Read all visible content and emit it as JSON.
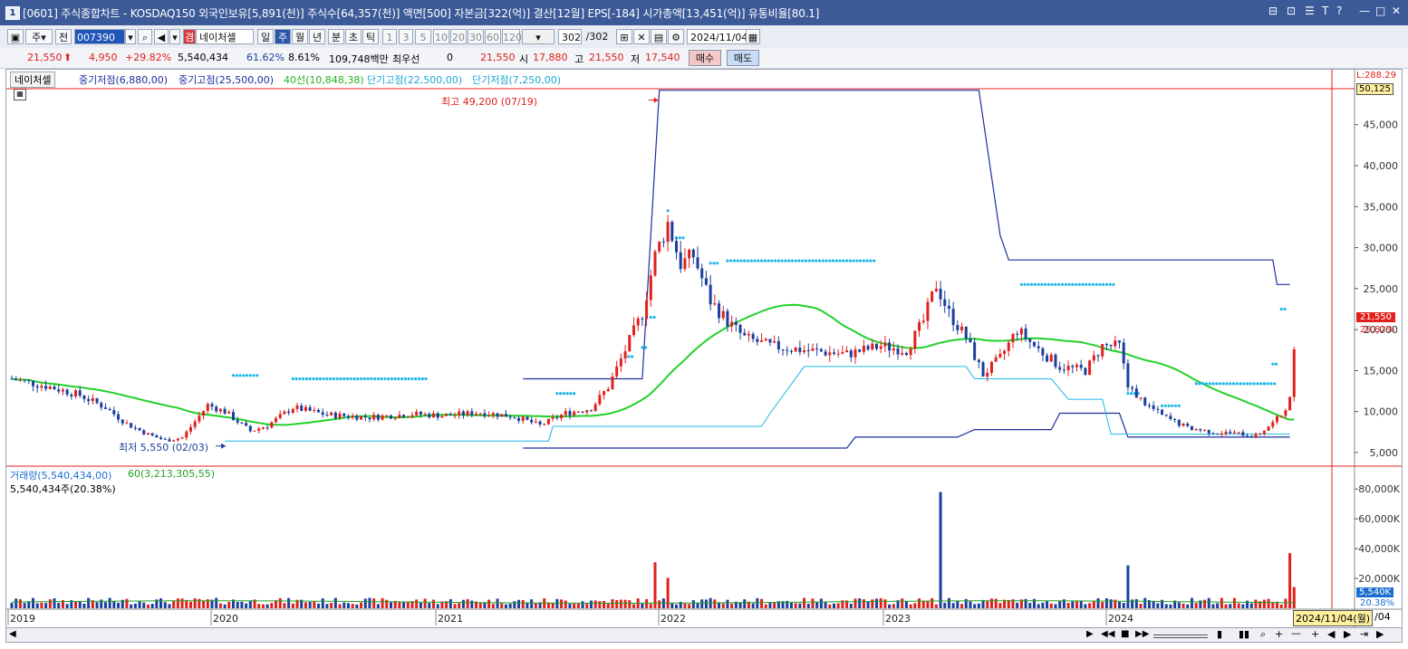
{
  "window": {
    "app_number": "1",
    "title": "[0601] 주식종합차트 - KOSDAQ150 외국인보유[5,891(천)] 주식수[64,357(천)] 액면[500] 자본금[322(억)] 결산[12월] EPS[-184] 시가총액[13,451(억)] 유통비율[80.1]"
  },
  "toolbar": {
    "period_select": "주",
    "all_label": "전",
    "stock_code": "007390",
    "stock_name": "네이처셀",
    "stock_badge": "겸",
    "timeframes": [
      "일",
      "주",
      "월",
      "년",
      "분",
      "초",
      "틱"
    ],
    "selected_timeframe": "주",
    "minute_options": [
      "1",
      "3",
      "5",
      "10",
      "20",
      "30",
      "60",
      "120"
    ],
    "count_display": "302",
    "count_total": "/302",
    "date": "2024/11/04"
  },
  "quote": {
    "price": "21,550",
    "change": "4,950",
    "change_pct": "+29.82%",
    "volume": "5,540,434",
    "vol_ratio": "61.62%",
    "turnover": "8.61%",
    "amount": "109,748백만",
    "pref_label": "최우선",
    "pref_value": "0",
    "price2": "21,550",
    "open_label": "시",
    "open": "17,880",
    "high_label": "고",
    "high": "21,550",
    "low_label": "저",
    "low": "17,540",
    "buy_label": "매수",
    "sell_label": "매도"
  },
  "chart": {
    "tab_label": "네이처셀",
    "legend": [
      {
        "text": "중기저점(6,880,00)",
        "color": "#1c2f9c"
      },
      {
        "text": "중기고점(25,500,00)",
        "color": "#1c2f9c"
      },
      {
        "text": "40선(10,848,38)",
        "color": "#22b322"
      },
      {
        "text": "단기고점(22,500,00)",
        "color": "#17a8d6"
      },
      {
        "text": "단기저점(7,250,00)",
        "color": "#17a8d6"
      }
    ],
    "high_annotation": "최고 49,200 (07/19)",
    "low_annotation": "최저 5,550 (02/03)",
    "price_axis_ticks": [
      "45,000",
      "40,000",
      "35,000",
      "30,000",
      "25,000",
      "20,000",
      "15,000",
      "10,000",
      "5,000"
    ],
    "crosshair_label": "L:288.29",
    "crosshair_value": "50,125",
    "last_price_tag": "21,550",
    "last_pct_tag": "29.82%",
    "volume_legend": [
      {
        "text": "거래량(5,540,434,00)",
        "color": "#1c6fd0"
      },
      {
        "text": "60(3,213,305,55)",
        "color": "#22a022"
      }
    ],
    "volume_sub": "5,540,434주(20.38%)",
    "volume_axis_ticks": [
      "80,000K",
      "60,000K",
      "40,000K",
      "20,000K"
    ],
    "last_volume_tag": "5,540K",
    "last_volume_pct": "20.38%",
    "x_axis_labels": [
      "2019",
      "2020",
      "2021",
      "2022",
      "2023",
      "2024"
    ],
    "x_axis_current": "2024/11/04(월)",
    "x_axis_tail": "/04"
  },
  "colors": {
    "up": "#e0201c",
    "down": "#1a3f9c",
    "ma40": "#22d02a",
    "mid_level": "#1c2f9c",
    "short_level": "#1fb6e8"
  },
  "chart_data": {
    "type": "line",
    "series": [
      {
        "name": "중기고점",
        "values": [
          25500
        ]
      },
      {
        "name": "중기저점",
        "values": [
          6880
        ]
      },
      {
        "name": "40선",
        "values": [
          10848.38
        ]
      },
      {
        "name": "단기고점",
        "values": [
          22500
        ]
      },
      {
        "name": "단기저점",
        "values": [
          7250
        ]
      }
    ],
    "price_range": [
      4000,
      49500
    ],
    "ohlc_last": {
      "open": 17880,
      "high": 21550,
      "low": 17540,
      "close": 21550
    },
    "high_marker": {
      "value": 49200,
      "date": "07/19"
    },
    "low_marker": {
      "value": 5550,
      "date": "02/03"
    },
    "volume_last": 5540434,
    "volume_ma60": 3213305.55
  }
}
